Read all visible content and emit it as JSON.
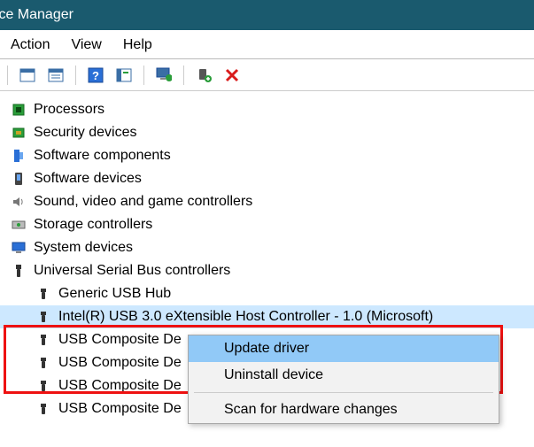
{
  "window": {
    "title": "evice Manager"
  },
  "menubar": {
    "action": "Action",
    "view": "View",
    "help": "Help"
  },
  "tree": {
    "processors": "Processors",
    "security": "Security devices",
    "software_components": "Software components",
    "software_devices": "Software devices",
    "sound": "Sound, video and game controllers",
    "storage": "Storage controllers",
    "system": "System devices",
    "usb": "Universal Serial Bus controllers",
    "usb_children": {
      "generic_hub": "Generic USB Hub",
      "intel_xhci": "Intel(R) USB 3.0 eXtensible Host Controller - 1.0 (Microsoft)",
      "composite1": "USB Composite De",
      "composite2": "USB Composite De",
      "composite3": "USB Composite De",
      "composite4": "USB Composite De"
    }
  },
  "context_menu": {
    "update": "Update driver",
    "uninstall": "Uninstall device",
    "scan": "Scan for hardware changes"
  }
}
